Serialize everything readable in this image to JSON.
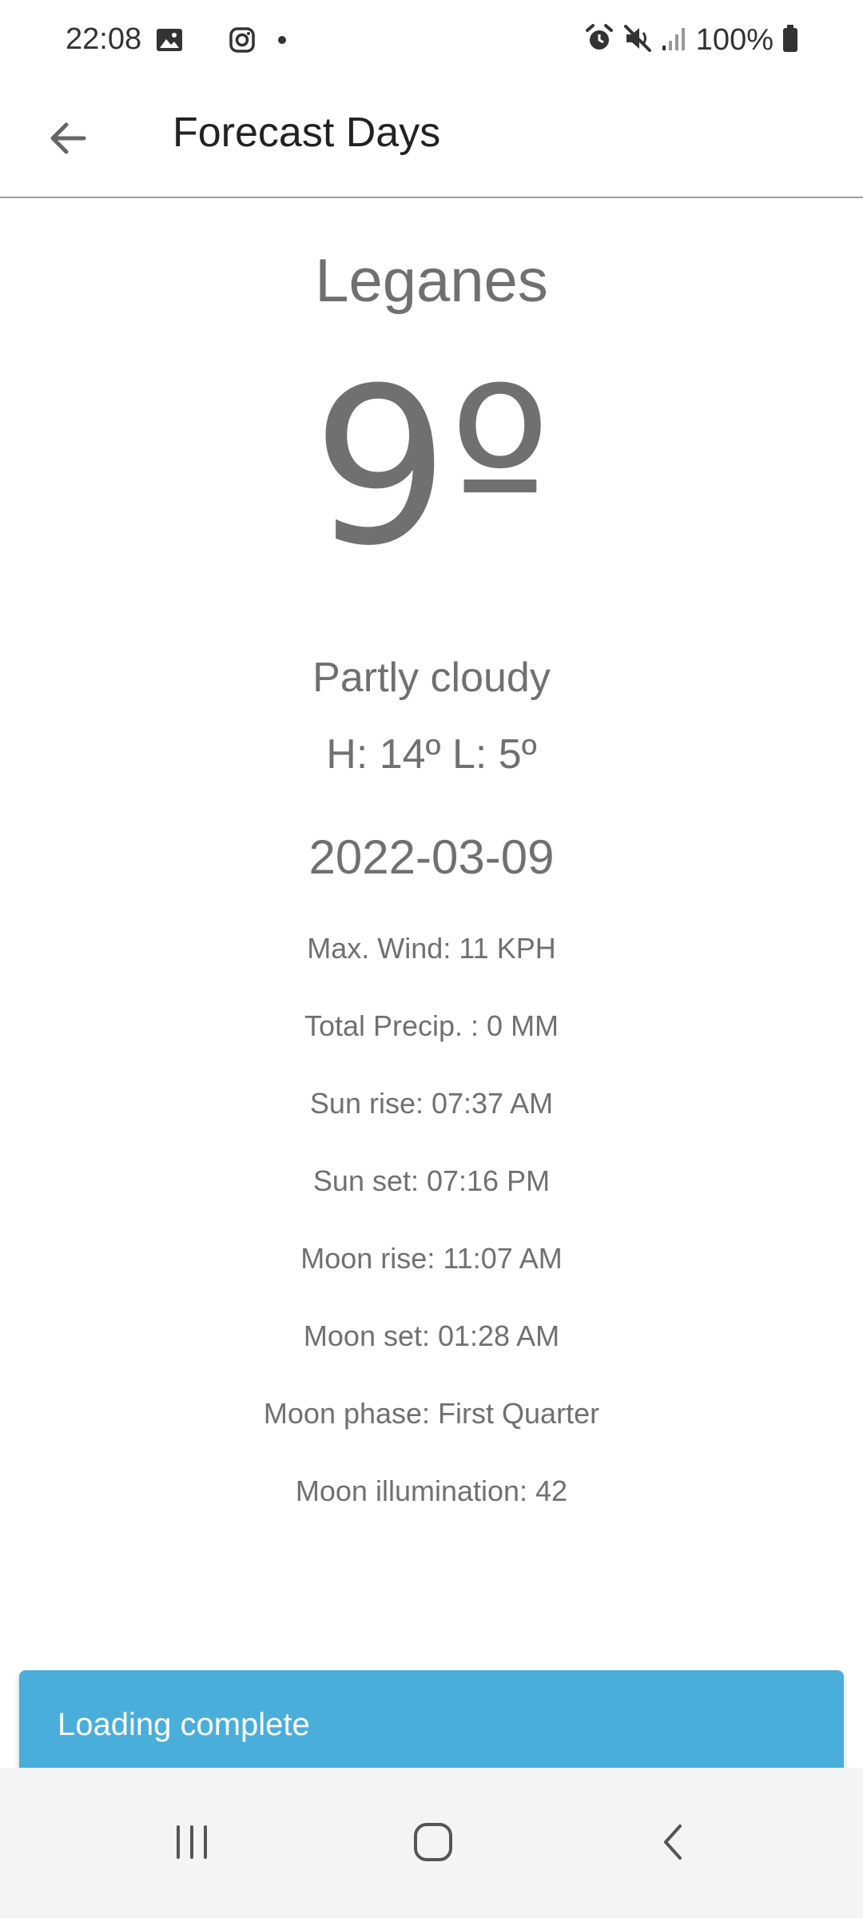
{
  "status_bar": {
    "time": "22:08",
    "left_icons": [
      "image-icon",
      "instagram-icon",
      "dot-icon"
    ],
    "right_icons": [
      "alarm-icon",
      "mute-icon",
      "signal-icon",
      "battery-icon"
    ],
    "battery": "100%"
  },
  "app_bar": {
    "title": "Forecast Days",
    "back_icon": "arrow-back-icon"
  },
  "forecast": {
    "city": "Leganes",
    "temperature": "9º",
    "condition": "Partly cloudy",
    "high_low": "H: 14º L: 5º",
    "date": "2022-03-09",
    "details": [
      "Max. Wind: 11 KPH",
      "Total Precip. : 0 MM",
      "Sun rise: 07:37 AM",
      "Sun set: 07:16 PM",
      "Moon rise: 11:07 AM",
      "Moon set: 01:28 AM",
      "Moon phase: First Quarter",
      "Moon illumination: 42"
    ]
  },
  "snackbar": {
    "message": "Loading complete",
    "color": "#4aaedb"
  },
  "nav_bar": {
    "icons": [
      "recents-icon",
      "home-icon",
      "back-icon"
    ]
  }
}
